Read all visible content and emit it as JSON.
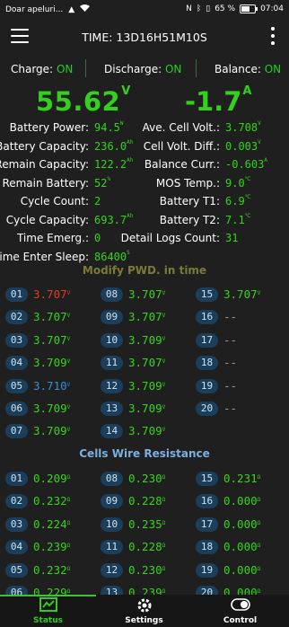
{
  "status_bar": {
    "carrier": "Doar apeluri...",
    "battery_percent": "65 %",
    "clock": "07:04",
    "battery_level": 0.65
  },
  "header": {
    "time": "TIME: 13D16H51M10S"
  },
  "switches": {
    "charge_label": "Charge:",
    "charge_value": "ON",
    "discharge_label": "Discharge:",
    "discharge_value": "ON",
    "balance_label": "Balance:",
    "balance_value": "ON"
  },
  "voltage": {
    "value": "55.62",
    "unit": "V"
  },
  "current": {
    "value": "-1.7",
    "unit": "A"
  },
  "stats_left": [
    {
      "label": "Battery Power:",
      "value": "94.5",
      "unit": "W"
    },
    {
      "label": "Battery Capacity:",
      "value": "236.0",
      "unit": "Ah"
    },
    {
      "label": "Remain Capacity:",
      "value": "122.2",
      "unit": "Ah"
    },
    {
      "label": "Remain Battery:",
      "value": "52",
      "unit": "%"
    },
    {
      "label": "Cycle Count:",
      "value": "2",
      "unit": ""
    },
    {
      "label": "Cycle Capacity:",
      "value": "693.7",
      "unit": "Ah"
    },
    {
      "label": "Time Emerg.:",
      "value": "0",
      "unit": ""
    },
    {
      "label": "Time Enter Sleep:",
      "value": "86400",
      "unit": "S"
    }
  ],
  "stats_right": [
    {
      "label": "Ave. Cell Volt.:",
      "value": "3.708",
      "unit": "V"
    },
    {
      "label": "Cell Volt. Diff.:",
      "value": "0.003",
      "unit": "V"
    },
    {
      "label": "Balance Curr.:",
      "value": "-0.603",
      "unit": "A"
    },
    {
      "label": "MOS Temp.:",
      "value": "9.0",
      "unit": "℃"
    },
    {
      "label": "Battery T1:",
      "value": "6.9",
      "unit": "℃"
    },
    {
      "label": "Battery T2:",
      "value": "7.1",
      "unit": "℃"
    },
    {
      "label": "Detail Logs Count:",
      "value": "31",
      "unit": ""
    }
  ],
  "modify_title": "Modify PWD. in time",
  "cells": [
    {
      "id": "01",
      "value": "3.707",
      "unit": "V",
      "color": "red"
    },
    {
      "id": "02",
      "value": "3.707",
      "unit": "V",
      "color": "green"
    },
    {
      "id": "03",
      "value": "3.707",
      "unit": "V",
      "color": "green"
    },
    {
      "id": "04",
      "value": "3.709",
      "unit": "V",
      "color": "green"
    },
    {
      "id": "05",
      "value": "3.710",
      "unit": "V",
      "color": "blue"
    },
    {
      "id": "06",
      "value": "3.709",
      "unit": "V",
      "color": "green"
    },
    {
      "id": "07",
      "value": "3.709",
      "unit": "V",
      "color": "green"
    },
    {
      "id": "08",
      "value": "3.707",
      "unit": "V",
      "color": "green"
    },
    {
      "id": "09",
      "value": "3.707",
      "unit": "V",
      "color": "green"
    },
    {
      "id": "10",
      "value": "3.709",
      "unit": "V",
      "color": "green"
    },
    {
      "id": "11",
      "value": "3.707",
      "unit": "V",
      "color": "green"
    },
    {
      "id": "12",
      "value": "3.709",
      "unit": "V",
      "color": "green"
    },
    {
      "id": "13",
      "value": "3.709",
      "unit": "V",
      "color": "green"
    },
    {
      "id": "14",
      "value": "3.709",
      "unit": "V",
      "color": "green"
    },
    {
      "id": "15",
      "value": "3.707",
      "unit": "V",
      "color": "green"
    },
    {
      "id": "16",
      "value": "--",
      "unit": "",
      "color": "dash"
    },
    {
      "id": "17",
      "value": "--",
      "unit": "",
      "color": "dash"
    },
    {
      "id": "18",
      "value": "--",
      "unit": "",
      "color": "dash"
    },
    {
      "id": "19",
      "value": "--",
      "unit": "",
      "color": "dash"
    },
    {
      "id": "20",
      "value": "--",
      "unit": "",
      "color": "dash"
    }
  ],
  "resistance_title": "Cells Wire Resistance",
  "resistances": [
    {
      "id": "01",
      "value": "0.209",
      "unit": "Ω"
    },
    {
      "id": "02",
      "value": "0.232",
      "unit": "Ω"
    },
    {
      "id": "03",
      "value": "0.224",
      "unit": "Ω"
    },
    {
      "id": "04",
      "value": "0.239",
      "unit": "Ω"
    },
    {
      "id": "05",
      "value": "0.232",
      "unit": "Ω"
    },
    {
      "id": "06",
      "value": "0.229",
      "unit": "Ω"
    },
    {
      "id": "08",
      "value": "0.230",
      "unit": "Ω"
    },
    {
      "id": "09",
      "value": "0.228",
      "unit": "Ω"
    },
    {
      "id": "10",
      "value": "0.235",
      "unit": "Ω"
    },
    {
      "id": "11",
      "value": "0.228",
      "unit": "Ω"
    },
    {
      "id": "12",
      "value": "0.230",
      "unit": "Ω"
    },
    {
      "id": "13",
      "value": "0.239",
      "unit": "Ω"
    },
    {
      "id": "15",
      "value": "0.231",
      "unit": "Ω"
    },
    {
      "id": "16",
      "value": "0.000",
      "unit": "Ω"
    },
    {
      "id": "17",
      "value": "0.000",
      "unit": "Ω"
    },
    {
      "id": "18",
      "value": "0.000",
      "unit": "Ω"
    },
    {
      "id": "19",
      "value": "0.000",
      "unit": "Ω"
    },
    {
      "id": "20",
      "value": "0.000",
      "unit": "Ω"
    }
  ],
  "nav": [
    {
      "label": "Status",
      "icon": "status-icon",
      "active": true
    },
    {
      "label": "Settings",
      "icon": "gear-icon",
      "active": false
    },
    {
      "label": "Control",
      "icon": "toggle-icon",
      "active": false
    }
  ],
  "colors": {
    "accent_green": "#33cc22",
    "value_red": "#e23b28",
    "value_blue": "#3d8ad6",
    "badge_bg": "#1b3e5a",
    "modify_title": "#7b7a37",
    "resistance_title": "#7bb0de"
  }
}
